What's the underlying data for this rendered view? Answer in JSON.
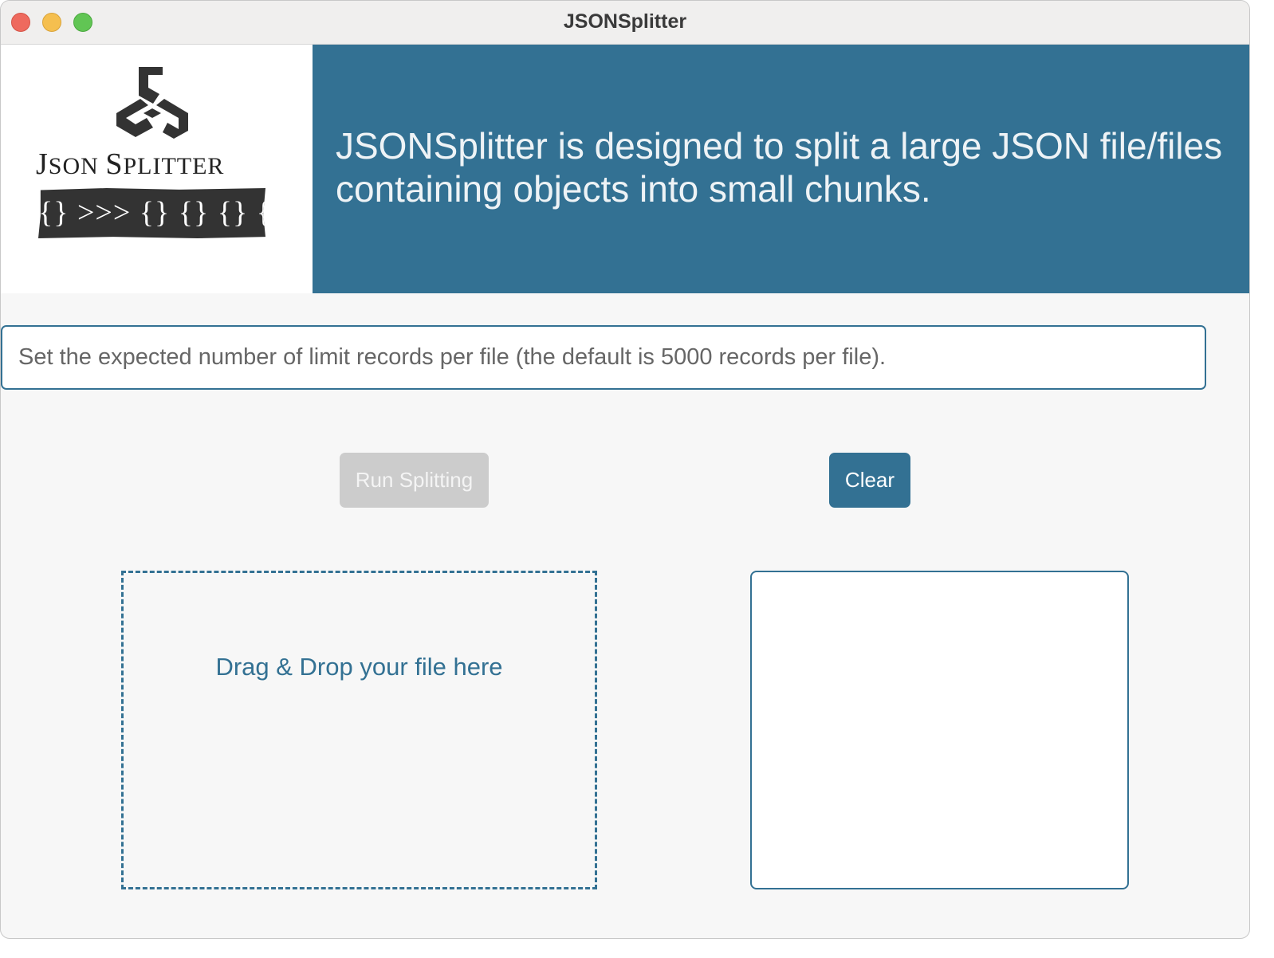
{
  "window": {
    "title": "JSONSplitter"
  },
  "logo": {
    "title_first": "J",
    "title_first_small": "SON ",
    "title_second": "S",
    "title_second_small": "PLITTER",
    "strip_text": "{} >>> {} {} {} {}"
  },
  "banner": {
    "text": "JSONSplitter is designed to split a large JSON file/files containing objects into small chunks."
  },
  "limit_input": {
    "placeholder": "Set the expected number of limit records per file (the default is 5000 records per file).",
    "value": ""
  },
  "buttons": {
    "run_label": "Run Splitting",
    "clear_label": "Clear"
  },
  "dropzone": {
    "label": "Drag & Drop your file here"
  },
  "colors": {
    "accent": "#337193",
    "disabled": "#cccccc",
    "background": "#f7f7f7"
  }
}
